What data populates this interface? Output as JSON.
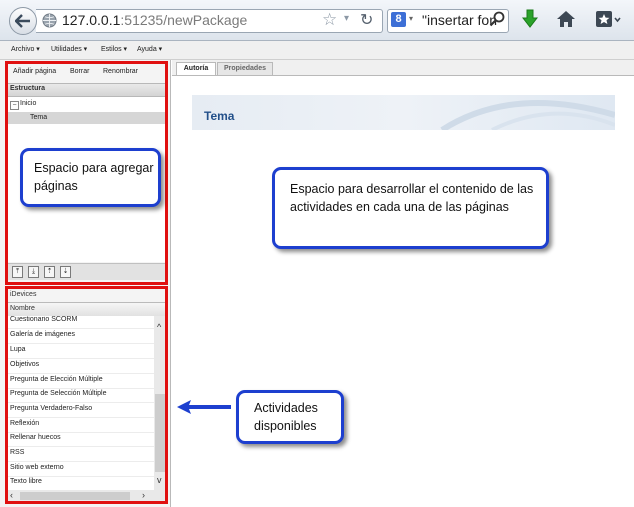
{
  "browser": {
    "url_host": "127.0.0.1",
    "url_rest": ":51235/newPackage",
    "search_text": "\"insertar fon",
    "search_engine_letter": "8"
  },
  "menu": {
    "items": [
      "Archivo ▾",
      "Utilidades ▾",
      "Estilos ▾",
      "Ayuda ▾"
    ]
  },
  "structure": {
    "buttons": [
      "Añadir página",
      "Borrar",
      "Renombrar"
    ],
    "header": "Estructura",
    "tree": {
      "root": "Inicio",
      "child": "Tema"
    },
    "nav_buttons": [
      "⤒",
      "⤓",
      "⇡",
      "⇣"
    ]
  },
  "idevices": {
    "header": "iDevices",
    "column": "Nombre",
    "items": [
      "Cuestionario SCORM",
      "Galería de imágenes",
      "Lupa",
      "Objetivos",
      "Pregunta de Elección Múltiple",
      "Pregunta de Selección Múltiple",
      "Pregunta Verdadero-Falso",
      "Reflexión",
      "Rellenar huecos",
      "RSS",
      "Sitio web externo",
      "Texto libre"
    ]
  },
  "tabs": [
    "Autoría",
    "Propiedades"
  ],
  "content": {
    "title": "Tema"
  },
  "annotations": {
    "left": "Espacio para agregar páginas",
    "center": "Espacio para desarrollar el contenido de las actividades en cada una de las páginas",
    "right": "Actividades disponibles"
  },
  "colors": {
    "highlight_box": "#e01010",
    "callout_border": "#1d3fcf",
    "title_blue": "#23508a"
  }
}
